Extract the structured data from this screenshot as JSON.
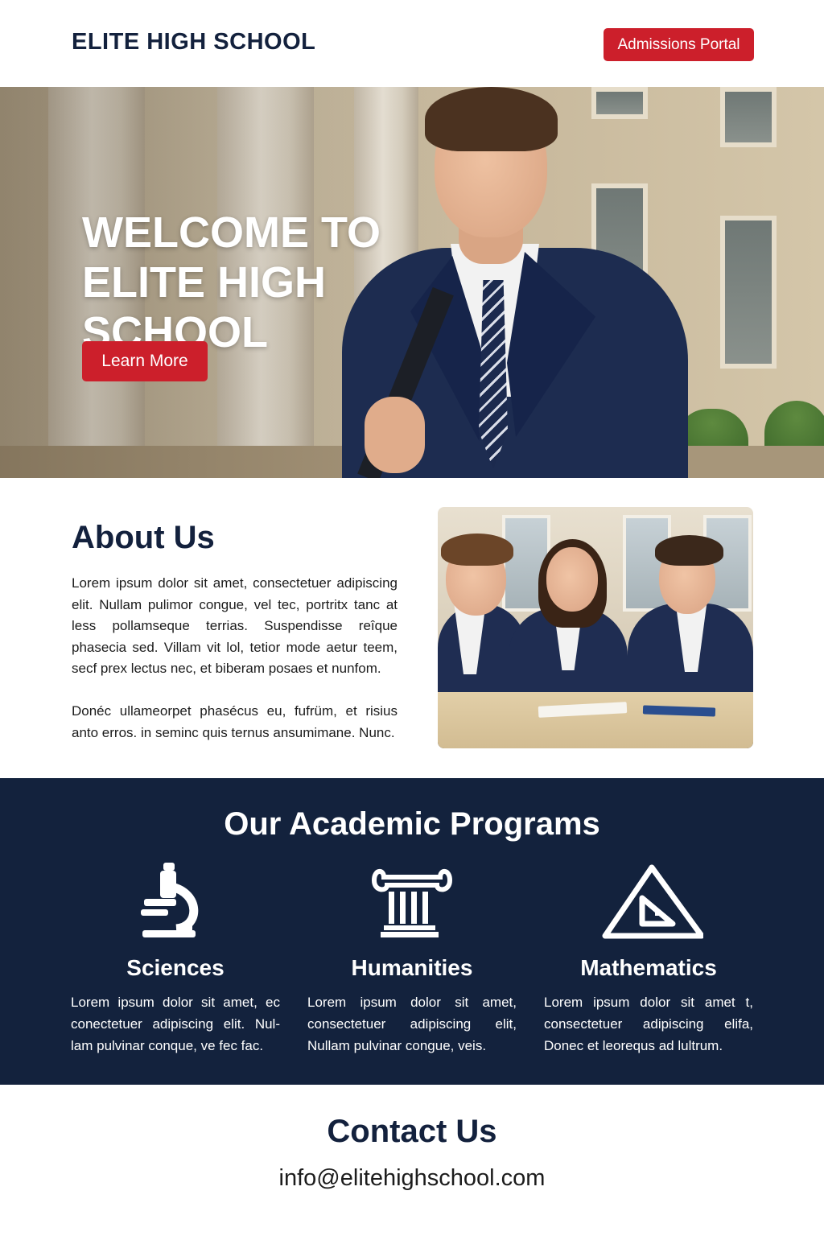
{
  "header": {
    "brand": "ELITE HIGH SCHOOL",
    "portal_button": "Admissions Portal"
  },
  "hero": {
    "title_lines": [
      "WELCOME TO",
      "ELITE HIGH",
      "SCHOOL"
    ],
    "button": "Learn More",
    "image": "photo of student in navy blazer in front of school building"
  },
  "about": {
    "heading": "About Us",
    "paragraphs": [
      "Lorem ipsum dolor sit amet, consectetuer adipiscing elit. Nullam pulimor congue, vel tec, portritx tanc at less pollamseque terrias. Suspendisse reîque phasecia sed. Villam vit lol, tetior mode aetur teem, secf prex lectus nec, et biberam posaes et nunfom.",
      "Donéc ullameorpet phasécus eu, fufrüm, et risius anto erros. in seminc quis ternus ansumimane. Nunc."
    ],
    "image": "photo of three students in uniforms at a desk"
  },
  "programs": {
    "heading": "Our Academic Programs",
    "items": [
      {
        "icon": "microscope-icon",
        "title": "Sciences",
        "text": "Lorem ipsum dolor sit amet, ec conectetuer adipiscing elit. Nul-lam pulvinar conque, ve fec fac."
      },
      {
        "icon": "column-icon",
        "title": "Humanities",
        "text": "Lorem ipsum dolor sit amet, consectetuer adipiscing elit, Nullam pulvinar congue, veis."
      },
      {
        "icon": "set-square-icon",
        "title": "Mathematics",
        "text": "Lorem ipsum dolor sit amet t, consectetuer adipiscing elifa, Donec et leorequs ad lultrum."
      }
    ]
  },
  "contact": {
    "heading": "Contact Us",
    "email": "info@elitehighschool.com"
  },
  "colors": {
    "navy": "#13223d",
    "accent_red": "#cc1f2b",
    "white": "#ffffff"
  }
}
